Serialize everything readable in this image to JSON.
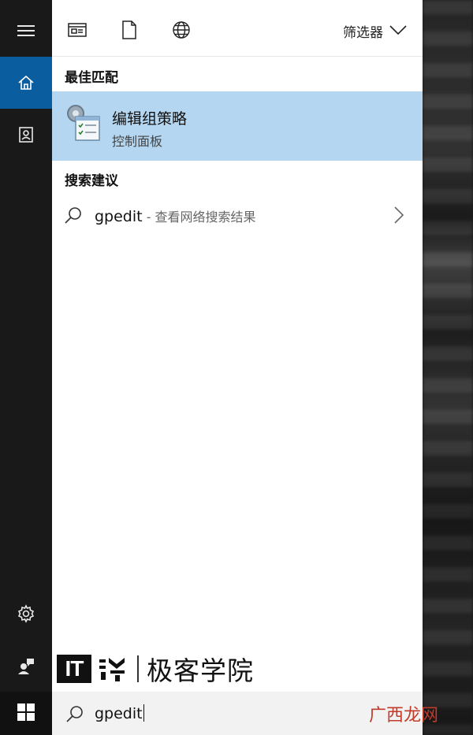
{
  "toolbar": {
    "filter_label": "筛选器",
    "icons": [
      "apps-icon",
      "document-icon",
      "web-globe-icon"
    ]
  },
  "rail": {
    "icons": [
      "hamburger-menu-icon",
      "home-icon",
      "notebook-icon",
      "settings-gear-icon",
      "feedback-icon",
      "windows-start-icon"
    ],
    "active": "home-icon"
  },
  "best_match": {
    "heading": "最佳匹配",
    "title": "编辑组策略",
    "subtitle": "控制面板"
  },
  "suggestions": {
    "heading": "搜索建议",
    "items": [
      {
        "query": "gpedit",
        "suffix": " - 查看网络搜索结果"
      }
    ]
  },
  "search": {
    "value": "gpedit"
  },
  "watermarks": {
    "logo_text": "IT",
    "brand_text": "极客学院",
    "corner_text": "广西龙网"
  },
  "colors": {
    "accent": "#0a5d9e",
    "selection": "#b5d6f0",
    "rail": "#191919"
  }
}
